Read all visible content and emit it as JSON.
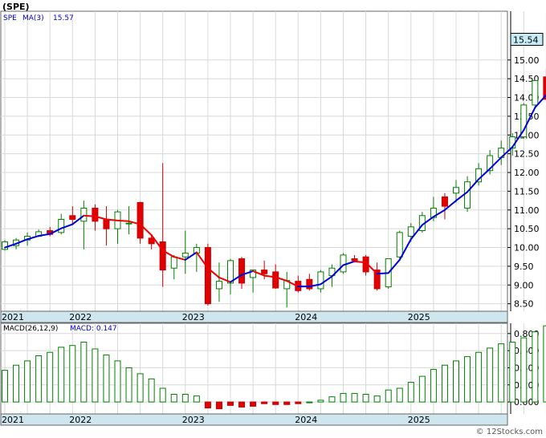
{
  "chart_data": [
    {
      "type": "candlestick",
      "title": "(SPE)",
      "legend": {
        "symbol": "SPE",
        "ma_label": "MA(3)",
        "ma_value": "15.57"
      },
      "last_price_label": "15.54",
      "ylim": [
        8.3,
        16.3
      ],
      "yticks": [
        "8.50",
        "9.00",
        "9.50",
        "10.00",
        "10.50",
        "11.00",
        "11.50",
        "12.00",
        "12.50",
        "13.00",
        "13.50",
        "14.00",
        "14.50",
        "15.00"
      ],
      "year_labels": [
        "2021",
        "2022",
        "2023",
        "2024",
        "2025"
      ],
      "series": [
        {
          "name": "price",
          "candles": [
            {
              "o": 9.95,
              "h": 10.2,
              "l": 9.92,
              "c": 10.15
            },
            {
              "o": 10.05,
              "h": 10.25,
              "l": 9.95,
              "c": 10.2
            },
            {
              "o": 10.2,
              "h": 10.4,
              "l": 10.05,
              "c": 10.3
            },
            {
              "o": 10.3,
              "h": 10.48,
              "l": 10.28,
              "c": 10.42
            },
            {
              "o": 10.45,
              "h": 10.55,
              "l": 10.3,
              "c": 10.35
            },
            {
              "o": 10.4,
              "h": 10.9,
              "l": 10.35,
              "c": 10.75
            },
            {
              "o": 10.85,
              "h": 11.1,
              "l": 10.6,
              "c": 10.75
            },
            {
              "o": 10.7,
              "h": 11.25,
              "l": 9.95,
              "c": 11.05
            },
            {
              "o": 11.05,
              "h": 11.15,
              "l": 10.45,
              "c": 10.7
            },
            {
              "o": 10.75,
              "h": 11.1,
              "l": 10.05,
              "c": 10.5
            },
            {
              "o": 10.5,
              "h": 11.0,
              "l": 10.1,
              "c": 10.95
            },
            {
              "o": 10.65,
              "h": 11.1,
              "l": 10.35,
              "c": 10.65
            },
            {
              "o": 11.2,
              "h": 11.22,
              "l": 10.1,
              "c": 10.25
            },
            {
              "o": 10.25,
              "h": 10.35,
              "l": 9.95,
              "c": 10.1
            },
            {
              "o": 10.15,
              "h": 12.25,
              "l": 8.95,
              "c": 9.4
            },
            {
              "o": 9.45,
              "h": 9.8,
              "l": 9.15,
              "c": 9.75
            },
            {
              "o": 9.75,
              "h": 10.45,
              "l": 9.3,
              "c": 9.85
            },
            {
              "o": 9.85,
              "h": 10.1,
              "l": 9.35,
              "c": 10.0
            },
            {
              "o": 10.0,
              "h": 10.1,
              "l": 8.45,
              "c": 8.5
            },
            {
              "o": 8.9,
              "h": 9.6,
              "l": 8.55,
              "c": 9.1
            },
            {
              "o": 9.05,
              "h": 9.7,
              "l": 8.75,
              "c": 9.65
            },
            {
              "o": 9.7,
              "h": 9.75,
              "l": 8.9,
              "c": 9.05
            },
            {
              "o": 9.2,
              "h": 9.4,
              "l": 8.8,
              "c": 9.4
            },
            {
              "o": 9.4,
              "h": 9.65,
              "l": 9.15,
              "c": 9.3
            },
            {
              "o": 9.35,
              "h": 9.55,
              "l": 8.9,
              "c": 8.92
            },
            {
              "o": 8.9,
              "h": 9.35,
              "l": 8.4,
              "c": 9.12
            },
            {
              "o": 9.1,
              "h": 9.25,
              "l": 8.8,
              "c": 8.85
            },
            {
              "o": 9.15,
              "h": 9.3,
              "l": 8.85,
              "c": 8.9
            },
            {
              "o": 8.9,
              "h": 9.4,
              "l": 8.8,
              "c": 9.35
            },
            {
              "o": 9.25,
              "h": 9.55,
              "l": 8.95,
              "c": 9.45
            },
            {
              "o": 9.35,
              "h": 9.85,
              "l": 9.3,
              "c": 9.8
            },
            {
              "o": 9.7,
              "h": 9.8,
              "l": 9.6,
              "c": 9.65
            },
            {
              "o": 9.75,
              "h": 9.8,
              "l": 9.25,
              "c": 9.35
            },
            {
              "o": 9.4,
              "h": 9.6,
              "l": 8.85,
              "c": 8.9
            },
            {
              "o": 8.95,
              "h": 9.7,
              "l": 8.9,
              "c": 9.7
            },
            {
              "o": 9.75,
              "h": 10.45,
              "l": 9.7,
              "c": 10.4
            },
            {
              "o": 10.3,
              "h": 10.65,
              "l": 10.15,
              "c": 10.55
            },
            {
              "o": 10.45,
              "h": 10.95,
              "l": 10.4,
              "c": 10.85
            },
            {
              "o": 10.8,
              "h": 11.35,
              "l": 10.7,
              "c": 11.05
            },
            {
              "o": 11.35,
              "h": 11.45,
              "l": 10.75,
              "c": 11.1
            },
            {
              "o": 11.45,
              "h": 11.8,
              "l": 11.2,
              "c": 11.6
            },
            {
              "o": 11.05,
              "h": 11.9,
              "l": 10.95,
              "c": 11.75
            },
            {
              "o": 11.75,
              "h": 12.25,
              "l": 11.65,
              "c": 12.1
            },
            {
              "o": 12.05,
              "h": 12.6,
              "l": 11.95,
              "c": 12.45
            },
            {
              "o": 12.4,
              "h": 12.85,
              "l": 12.2,
              "c": 12.65
            },
            {
              "o": 12.65,
              "h": 13.05,
              "l": 12.45,
              "c": 12.95
            },
            {
              "o": 12.95,
              "h": 13.85,
              "l": 12.9,
              "c": 13.8
            },
            {
              "o": 13.8,
              "h": 14.45,
              "l": 13.75,
              "c": 14.45
            },
            {
              "o": 14.55,
              "h": 14.75,
              "l": 14.0,
              "c": 13.95
            },
            {
              "o": 13.95,
              "h": 14.75,
              "l": 13.55,
              "c": 14.7
            },
            {
              "o": 14.25,
              "h": 14.85,
              "l": 14.05,
              "c": 14.75
            },
            {
              "o": 14.8,
              "h": 15.2,
              "l": 14.65,
              "c": 14.7
            },
            {
              "o": 14.75,
              "h": 14.85,
              "l": 12.35,
              "c": 14.55
            },
            {
              "o": 14.7,
              "h": 14.75,
              "l": 14.15,
              "c": 14.25
            },
            {
              "o": 14.3,
              "h": 15.0,
              "l": 14.2,
              "c": 14.95
            },
            {
              "o": 14.95,
              "h": 15.4,
              "l": 14.7,
              "c": 15.3
            },
            {
              "o": 15.3,
              "h": 15.55,
              "l": 15.1,
              "c": 15.45
            },
            {
              "o": 15.45,
              "h": 15.55,
              "l": 15.2,
              "c": 15.5
            },
            {
              "o": 15.55,
              "h": 15.6,
              "l": 15.0,
              "c": 15.45
            },
            {
              "o": 15.6,
              "h": 15.85,
              "l": 15.3,
              "c": 15.45
            },
            {
              "o": 15.55,
              "h": 15.6,
              "l": 15.15,
              "c": 15.54
            }
          ]
        },
        {
          "name": "MA(3)",
          "values": [
            10.0,
            10.1,
            10.22,
            10.31,
            10.36,
            10.51,
            10.62,
            10.85,
            10.83,
            10.75,
            10.72,
            10.7,
            10.62,
            10.33,
            9.92,
            9.75,
            9.67,
            9.87,
            9.45,
            9.2,
            9.08,
            9.27,
            9.37,
            9.25,
            9.21,
            9.11,
            8.96,
            8.96,
            9.02,
            9.23,
            9.53,
            9.63,
            9.6,
            9.3,
            9.32,
            9.67,
            10.22,
            10.6,
            10.82,
            11.0,
            11.25,
            11.48,
            11.82,
            12.1,
            12.4,
            12.68,
            13.13,
            13.73,
            14.07,
            14.37,
            14.63,
            14.72,
            14.67,
            14.5,
            14.58,
            14.83,
            15.23,
            15.42,
            15.47,
            15.47,
            15.48
          ]
        }
      ]
    },
    {
      "type": "bar",
      "title": "MACD(26,12,9)",
      "legend": {
        "macd_label": "MACD: 0.147"
      },
      "ylim": [
        -0.14,
        0.92
      ],
      "yticks": [
        "0.000",
        "0.200",
        "0.400",
        "0.600",
        "0.800"
      ],
      "year_labels": [
        "2021",
        "2022",
        "2023",
        "2024",
        "2025"
      ],
      "values": [
        0.37,
        0.43,
        0.48,
        0.54,
        0.58,
        0.64,
        0.66,
        0.7,
        0.62,
        0.55,
        0.48,
        0.4,
        0.33,
        0.27,
        0.16,
        0.09,
        0.09,
        0.07,
        -0.07,
        -0.08,
        -0.04,
        -0.06,
        -0.05,
        -0.02,
        -0.03,
        -0.03,
        -0.02,
        0.0,
        0.02,
        0.06,
        0.1,
        0.1,
        0.09,
        0.07,
        0.14,
        0.16,
        0.23,
        0.3,
        0.38,
        0.43,
        0.48,
        0.53,
        0.58,
        0.63,
        0.68,
        0.7,
        0.75,
        0.82,
        0.89,
        0.8,
        0.8,
        0.77,
        0.71,
        0.6,
        0.48,
        0.4,
        0.38,
        0.35,
        0.3,
        0.23,
        0.15
      ]
    }
  ],
  "footer": {
    "copyright": "© 12Stocks.com"
  }
}
